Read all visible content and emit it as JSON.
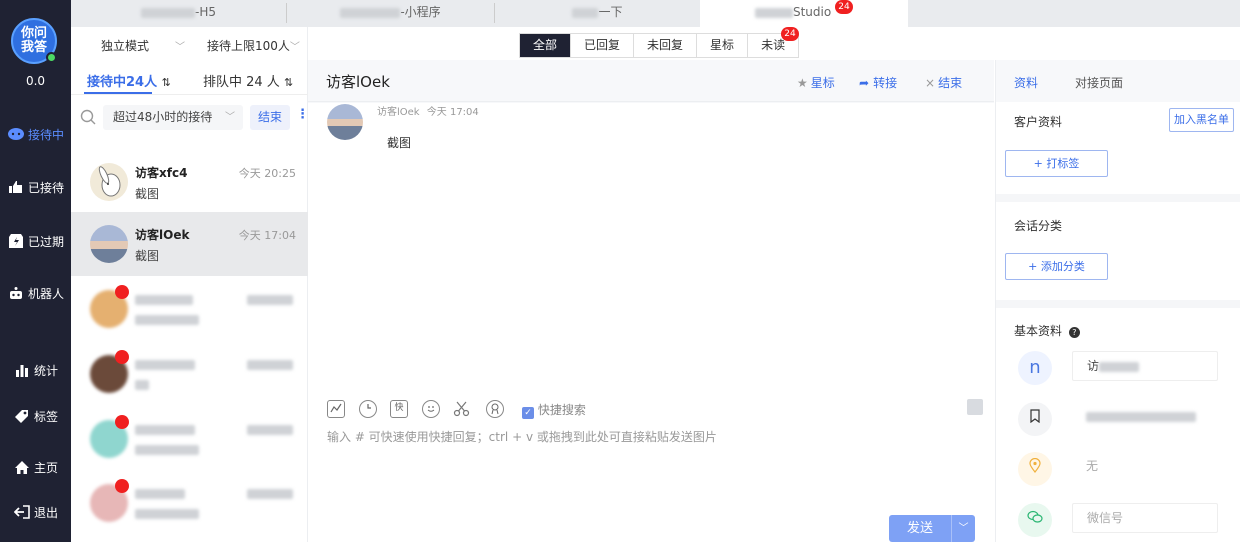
{
  "sidebar": {
    "logo_text": "你问我答",
    "score": "0.0",
    "items": [
      {
        "label": "接待中",
        "icon": "chat-bubble-icon"
      },
      {
        "label": "已接待",
        "icon": "thumbs-up-icon"
      },
      {
        "label": "已过期",
        "icon": "expired-icon"
      },
      {
        "label": "机器人",
        "icon": "robot-icon"
      },
      {
        "label": "统计",
        "icon": "bar-chart-icon"
      },
      {
        "label": "标签",
        "icon": "tag-icon"
      },
      {
        "label": "主页",
        "icon": "home-icon"
      },
      {
        "label": "退出",
        "icon": "logout-icon"
      }
    ]
  },
  "top_tabs": [
    {
      "label": "-H5"
    },
    {
      "label": "-小程序"
    },
    {
      "label": "一下"
    },
    {
      "label": "Studio",
      "badge": "24"
    }
  ],
  "list": {
    "mode": "独立模式",
    "limit": "接待上限100人",
    "tab_serving": "接待中24人",
    "tab_queue": "排队中 24 人",
    "filter": "超过48小时的接待",
    "end_label": "结束",
    "conversations": [
      {
        "name": "访客xfc4",
        "message": "截图",
        "time": "今天 20:25"
      },
      {
        "name": "访客lOek",
        "message": "截图",
        "time": "今天 17:04"
      }
    ]
  },
  "filters": {
    "pills": [
      "全部",
      "已回复",
      "未回复",
      "星标",
      "未读"
    ],
    "unread_badge": "24"
  },
  "chat": {
    "title": "访客lOek",
    "star": "星标",
    "transfer": "转接",
    "end": "结束",
    "message_sender": "访客lOek",
    "message_time": "今天 17:04",
    "message_text": "截图",
    "quick_search": "快捷搜索",
    "input_placeholder": "输入 # 可快速使用快捷回复；ctrl + v 或拖拽到此处可直接粘贴发送图片",
    "send": "发送"
  },
  "info": {
    "tab_profile": "资料",
    "tab_page": "对接页面",
    "customer_profile": "客户资料",
    "blacklist": "加入黑名单",
    "add_tag": "+ 打标签",
    "session_category": "会话分类",
    "add_category": "+ 添加分类",
    "basic_info": "基本资料",
    "name_value": "访",
    "location_value": "无",
    "wechat_placeholder": "微信号",
    "avatar_letter": "n"
  },
  "colors": {
    "accent": "#3b6ee8",
    "sidebar_bg": "#1f2233",
    "badge": "#f02020"
  }
}
